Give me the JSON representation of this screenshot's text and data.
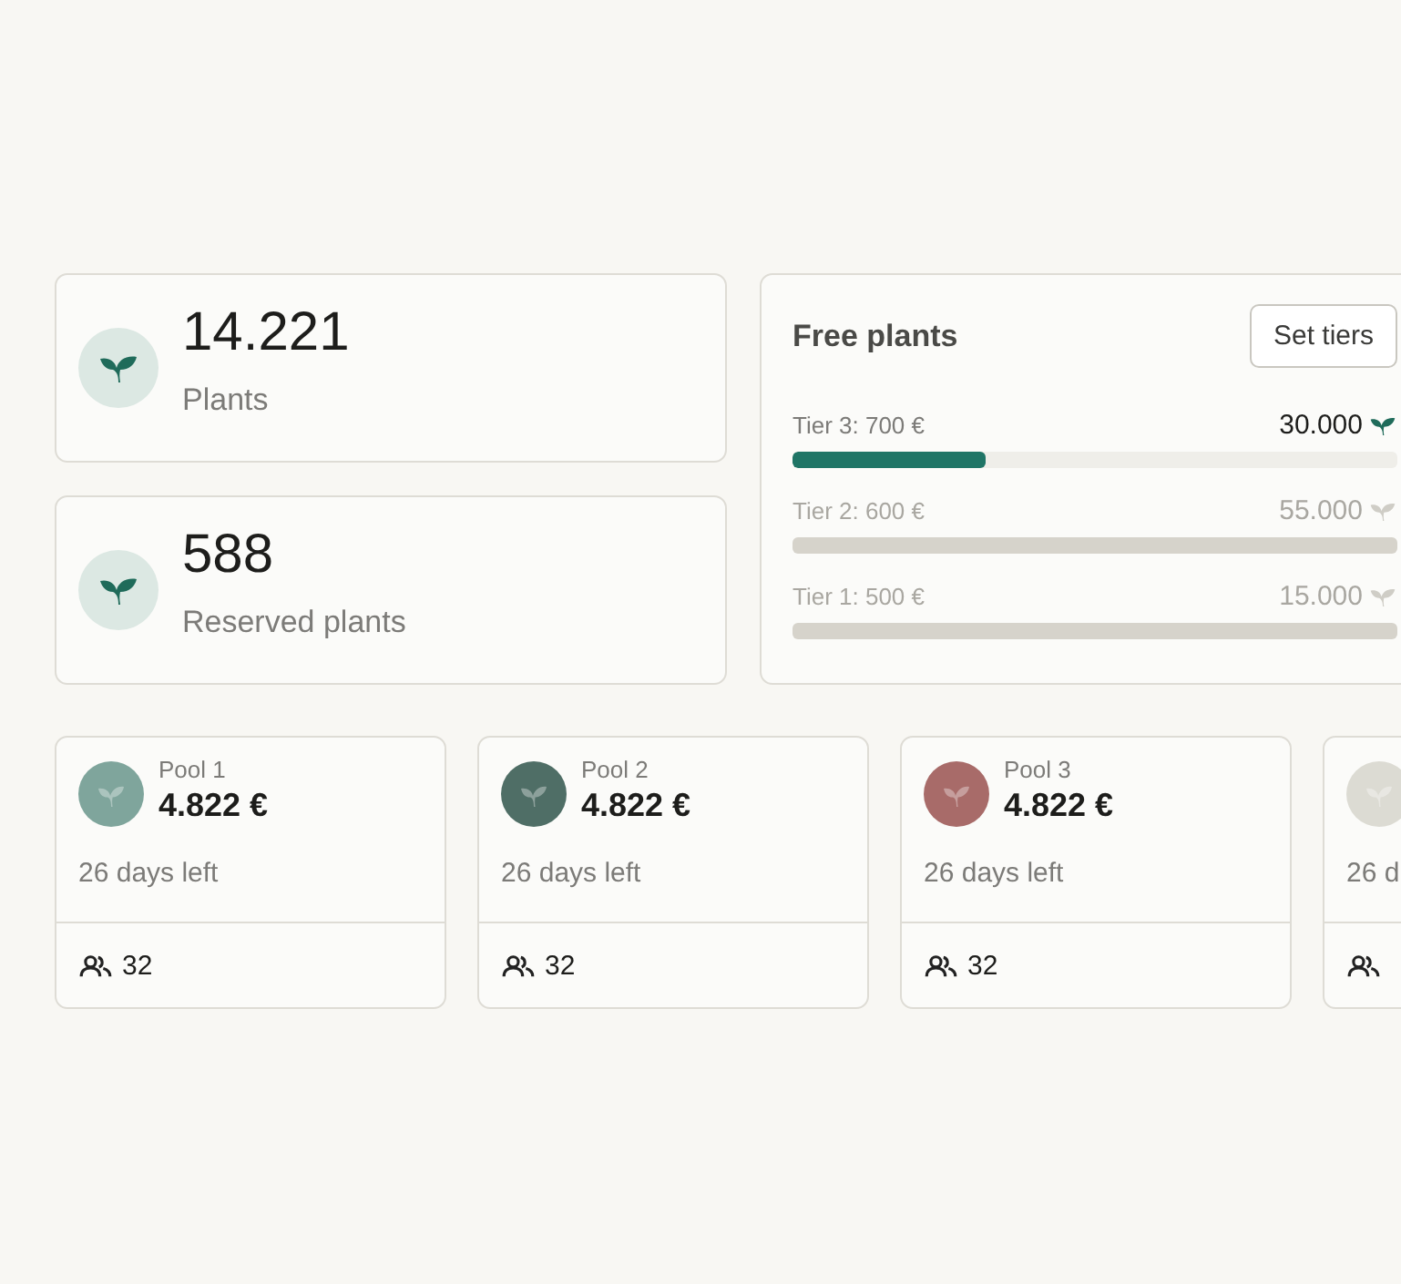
{
  "stats": [
    {
      "value": "14.221",
      "label": "Plants"
    },
    {
      "value": "588",
      "label": "Reserved plants"
    }
  ],
  "free_plants": {
    "title": "Free plants",
    "button": "Set tiers",
    "tiers": [
      {
        "label": "Tier 3: 700 €",
        "amount": "30.000",
        "active": true,
        "level": 0.32
      },
      {
        "label": "Tier 2: 600 €",
        "amount": "55.000",
        "active": false
      },
      {
        "label": "Tier 1: 500 €",
        "amount": "15.000",
        "active": false
      }
    ]
  },
  "pools": [
    {
      "name": "Pool 1",
      "amount": "4.822 €",
      "days": "26 days left",
      "members": "32",
      "color": "#7fa59c"
    },
    {
      "name": "Pool 2",
      "amount": "4.822 €",
      "days": "26 days left",
      "members": "32",
      "color": "#4f6e66"
    },
    {
      "name": "Pool 3",
      "amount": "4.822 €",
      "days": "26 days left",
      "members": "32",
      "color": "#a86b69"
    },
    {
      "days": "26 d",
      "color": "#dcdbd3"
    }
  ]
}
